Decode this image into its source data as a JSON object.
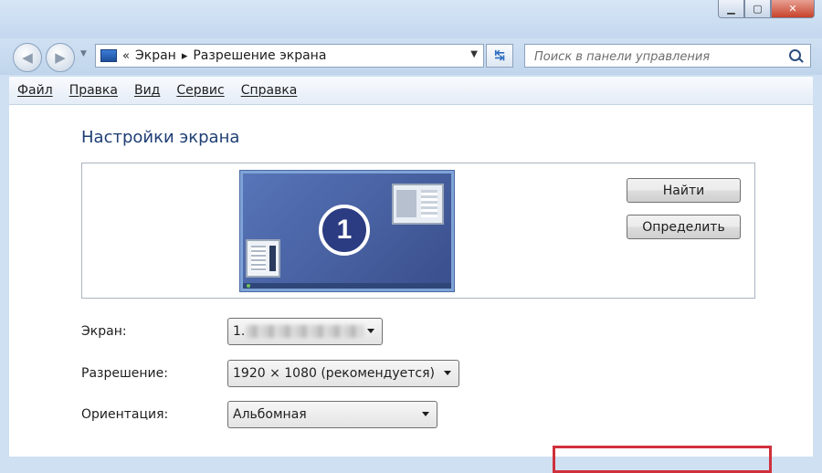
{
  "window": {
    "minimize_glyph": "▁",
    "maximize_glyph": "▢",
    "close_glyph": "✕"
  },
  "nav": {
    "back_glyph": "◀",
    "forward_glyph": "▶",
    "address": {
      "overflow": "«",
      "separator": "▸",
      "crumbs": [
        "Экран",
        "Разрешение экрана"
      ]
    },
    "refresh_glyph": "↹",
    "search_placeholder": "Поиск в панели управления"
  },
  "menu": {
    "items": [
      "Файл",
      "Правка",
      "Вид",
      "Сервис",
      "Справка"
    ]
  },
  "content": {
    "title": "Настройки экрана",
    "monitor_number": "1",
    "buttons": {
      "find": "Найти",
      "identify": "Определить"
    },
    "fields": {
      "screen": {
        "label": "Экран:",
        "value": "1."
      },
      "resolution": {
        "label": "Разрешение:",
        "value": "1920 × 1080 (рекомендуется)"
      },
      "orientation": {
        "label": "Ориентация:",
        "value": "Альбомная"
      }
    }
  },
  "colors": {
    "title": "#1e3e74",
    "monitor_bg": "#4a63a8",
    "highlight_box": "#d0303c"
  },
  "icons": {
    "address_icon": "control-panel-icon",
    "search_icon": "magnifier"
  }
}
